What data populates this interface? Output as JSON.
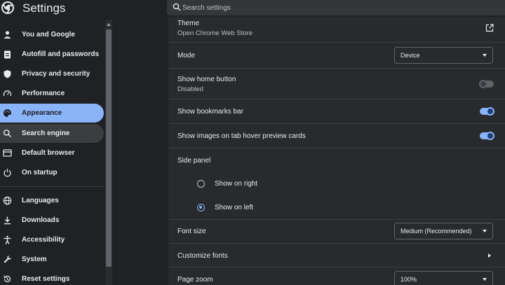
{
  "app": {
    "title": "Settings",
    "logo_icon": "chrome-logo-icon"
  },
  "search": {
    "placeholder": "Search settings"
  },
  "sidebar": {
    "items": [
      {
        "label": "You and Google",
        "icon": "person-icon"
      },
      {
        "label": "Autofill and passwords",
        "icon": "clipboard-icon"
      },
      {
        "label": "Privacy and security",
        "icon": "shield-icon"
      },
      {
        "label": "Performance",
        "icon": "speedometer-icon"
      },
      {
        "label": "Appearance",
        "icon": "palette-icon",
        "active": true
      },
      {
        "label": "Search engine",
        "icon": "search-icon"
      },
      {
        "label": "Default browser",
        "icon": "browser-icon"
      },
      {
        "label": "On startup",
        "icon": "power-icon"
      },
      {
        "label": "Languages",
        "icon": "globe-icon"
      },
      {
        "label": "Downloads",
        "icon": "download-icon"
      },
      {
        "label": "Accessibility",
        "icon": "accessibility-icon"
      },
      {
        "label": "System",
        "icon": "wrench-icon"
      },
      {
        "label": "Reset settings",
        "icon": "reset-icon"
      }
    ]
  },
  "appearance": {
    "theme": {
      "title": "Theme",
      "subtitle": "Open Chrome Web Store"
    },
    "mode": {
      "title": "Mode",
      "value": "Device"
    },
    "home_button": {
      "title": "Show home button",
      "subtitle": "Disabled",
      "enabled": false
    },
    "bookmarks_bar": {
      "title": "Show bookmarks bar",
      "enabled": true
    },
    "tab_hover_images": {
      "title": "Show images on tab hover preview cards",
      "enabled": true
    },
    "side_panel": {
      "title": "Side panel",
      "options": [
        {
          "label": "Show on right",
          "checked": false
        },
        {
          "label": "Show on left",
          "checked": true
        }
      ]
    },
    "font_size": {
      "title": "Font size",
      "value": "Medium (Recommended)"
    },
    "customize_fonts": {
      "title": "Customize fonts"
    },
    "page_zoom": {
      "title": "Page zoom",
      "value": "100%"
    }
  },
  "colors": {
    "accent": "#8ab4f8",
    "background": "#202124",
    "card": "#292a2d"
  }
}
